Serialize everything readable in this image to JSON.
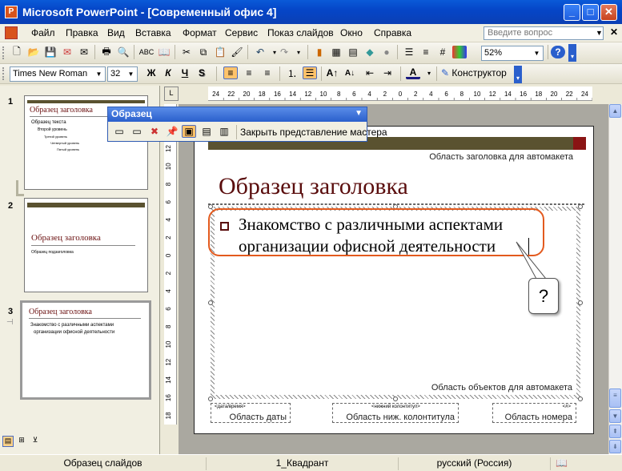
{
  "window": {
    "title": "Microsoft PowerPoint - [Современный офис 4]",
    "app_icon": "powerpoint-icon",
    "buttons": [
      "minimize",
      "maximize",
      "close"
    ]
  },
  "menu": {
    "items": [
      "Файл",
      "Правка",
      "Вид",
      "Вставка",
      "Формат",
      "Сервис",
      "Показ слайдов",
      "Окно",
      "Справка"
    ],
    "help_placeholder": "Введите вопрос"
  },
  "standard_toolbar": {
    "zoom": "52%"
  },
  "format_toolbar": {
    "font": "Times New Roman",
    "size": "32",
    "bold": "Ж",
    "italic": "К",
    "underline": "Ч",
    "shadow": "S",
    "designer_label": "Конструктор"
  },
  "master_toolbar": {
    "title": "Образец",
    "close_label": "Закрыть представление мастера"
  },
  "ruler": {
    "h_ticks": [
      "24",
      "22",
      "20",
      "18",
      "16",
      "14",
      "12",
      "10",
      "8",
      "6",
      "4",
      "2",
      "0",
      "2",
      "4",
      "6",
      "8",
      "10",
      "12",
      "14",
      "16",
      "18",
      "20",
      "22",
      "24"
    ],
    "v_ticks": [
      "16",
      "14",
      "12",
      "10",
      "8",
      "6",
      "4",
      "2",
      "0",
      "2",
      "4",
      "6",
      "8",
      "10",
      "12",
      "14",
      "16",
      "18"
    ]
  },
  "thumbnails": [
    {
      "num": "1",
      "title": "Образец заголовка",
      "lines": [
        "Образец текста",
        "Второй уровень",
        "Третий уровень",
        "Четвертый уровень",
        "Пятый уровень"
      ]
    },
    {
      "num": "2",
      "title": "Образец заголовка",
      "subtitle": "Образец подзаголовка"
    },
    {
      "num": "3",
      "title": "Образец заголовка",
      "lines": [
        "Знакомство с различными аспектами",
        "организации офисной деятельности"
      ]
    }
  ],
  "slide": {
    "title_area_label": "Область заголовка для автомакета",
    "title": "Образец заголовка",
    "body_line1": "Знакомство с различными аспектами",
    "body_line2": "организации офисной деятельности",
    "objects_area_label": "Область объектов для автомакета",
    "footer_date_small": "<дата/время>",
    "footer_date_label": "Область даты",
    "footer_center_small": "<нижний колонтитул>",
    "footer_center_label": "Область ниж. колонтитула",
    "footer_num_small": "<#>",
    "footer_num_label": "Область номера",
    "callout_text": "?"
  },
  "status": {
    "view": "Образец слайдов",
    "design": "1_Квадрант",
    "language": "русский (Россия)"
  },
  "colors": {
    "title_bar": "#0a5ad8",
    "slide_title": "#5a0d0d",
    "callout": "#e35a1e",
    "slide_bar": "#5a5230",
    "slide_accent": "#8a1414"
  }
}
